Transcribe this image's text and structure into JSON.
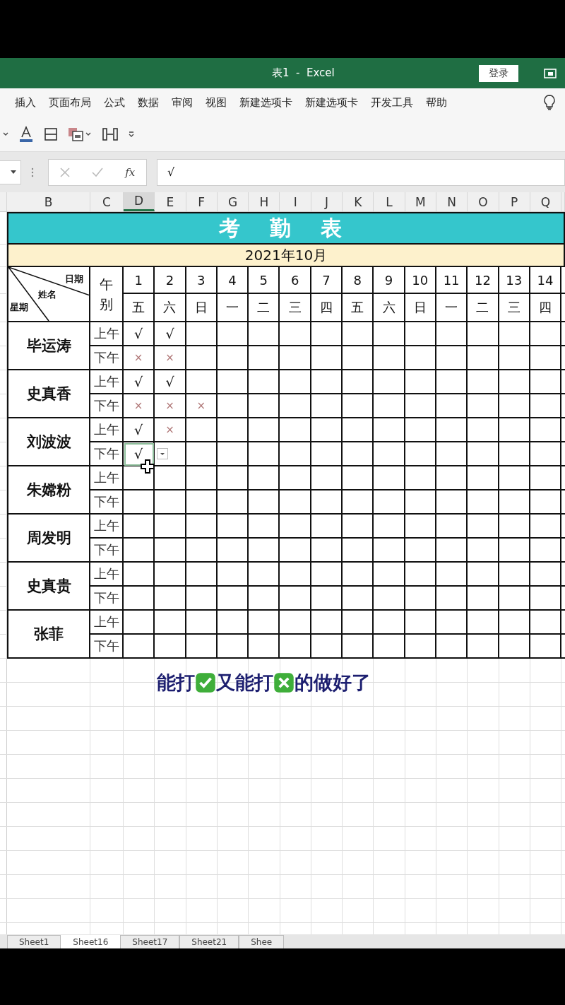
{
  "window": {
    "title": "表1  -  Excel",
    "login_button": "登录"
  },
  "ribbon_tabs": [
    "插入",
    "页面布局",
    "公式",
    "数据",
    "审阅",
    "视图",
    "新建选项卡",
    "新建选项卡",
    "开发工具",
    "帮助"
  ],
  "formula_bar": {
    "function_label": "fx",
    "value": "√"
  },
  "column_headers": [
    {
      "label": "B",
      "selected": false
    },
    {
      "label": "C",
      "selected": false
    },
    {
      "label": "D",
      "selected": true
    },
    {
      "label": "E",
      "selected": false
    },
    {
      "label": "F",
      "selected": false
    },
    {
      "label": "G",
      "selected": false
    },
    {
      "label": "H",
      "selected": false
    },
    {
      "label": "I",
      "selected": false
    },
    {
      "label": "J",
      "selected": false
    },
    {
      "label": "K",
      "selected": false
    },
    {
      "label": "L",
      "selected": false
    },
    {
      "label": "M",
      "selected": false
    },
    {
      "label": "N",
      "selected": false
    },
    {
      "label": "O",
      "selected": false
    },
    {
      "label": "P",
      "selected": false
    },
    {
      "label": "Q",
      "selected": false
    }
  ],
  "sheet": {
    "title": "考 勤 表",
    "month": "2021年10月",
    "corner": {
      "top": "日期",
      "middle": "姓名",
      "bottom": "星期"
    },
    "period_header": "午别",
    "days": [
      {
        "date": "1",
        "weekday": "五"
      },
      {
        "date": "2",
        "weekday": "六"
      },
      {
        "date": "3",
        "weekday": "日"
      },
      {
        "date": "4",
        "weekday": "一"
      },
      {
        "date": "5",
        "weekday": "二"
      },
      {
        "date": "6",
        "weekday": "三"
      },
      {
        "date": "7",
        "weekday": "四"
      },
      {
        "date": "8",
        "weekday": "五"
      },
      {
        "date": "9",
        "weekday": "六"
      },
      {
        "date": "10",
        "weekday": "日"
      },
      {
        "date": "11",
        "weekday": "一"
      },
      {
        "date": "12",
        "weekday": "二"
      },
      {
        "date": "13",
        "weekday": "三"
      },
      {
        "date": "14",
        "weekday": "四"
      }
    ],
    "employees": [
      {
        "name": "毕运涛",
        "rows": [
          {
            "period": "上午",
            "marks": [
              {
                "kind": "check",
                "value": "√",
                "selected": false
              },
              {
                "kind": "check",
                "value": "√",
                "selected": false
              }
            ]
          },
          {
            "period": "下午",
            "marks": [
              {
                "kind": "cross",
                "value": "×",
                "selected": false
              },
              {
                "kind": "cross",
                "value": "×",
                "selected": false
              }
            ]
          }
        ]
      },
      {
        "name": "史真香",
        "rows": [
          {
            "period": "上午",
            "marks": [
              {
                "kind": "check",
                "value": "√",
                "selected": false
              },
              {
                "kind": "check",
                "value": "√",
                "selected": false
              }
            ]
          },
          {
            "period": "下午",
            "marks": [
              {
                "kind": "cross",
                "value": "×",
                "selected": false
              },
              {
                "kind": "cross",
                "value": "×",
                "selected": false
              },
              {
                "kind": "cross",
                "value": "×",
                "selected": false
              }
            ]
          }
        ]
      },
      {
        "name": "刘波波",
        "rows": [
          {
            "period": "上午",
            "marks": [
              {
                "kind": "check",
                "value": "√",
                "selected": false
              },
              {
                "kind": "cross",
                "value": "×",
                "selected": false
              }
            ]
          },
          {
            "period": "下午",
            "marks": [
              {
                "kind": "check",
                "value": "√",
                "selected": true
              }
            ]
          }
        ]
      },
      {
        "name": "朱嫦粉",
        "rows": [
          {
            "period": "上午",
            "marks": []
          },
          {
            "period": "下午",
            "marks": []
          }
        ]
      },
      {
        "name": "周发明",
        "rows": [
          {
            "period": "上午",
            "marks": []
          },
          {
            "period": "下午",
            "marks": []
          }
        ]
      },
      {
        "name": "史真贵",
        "rows": [
          {
            "period": "上午",
            "marks": []
          },
          {
            "period": "下午",
            "marks": []
          }
        ]
      },
      {
        "name": "张菲",
        "rows": [
          {
            "period": "上午",
            "marks": []
          },
          {
            "period": "下午",
            "marks": []
          }
        ]
      }
    ]
  },
  "caption": [
    {
      "kind": "text",
      "text": "能打"
    },
    {
      "kind": "check-emoji"
    },
    {
      "kind": "text",
      "text": "又能打"
    },
    {
      "kind": "cross-emoji"
    },
    {
      "kind": "text",
      "text": "的做好了"
    }
  ],
  "sheet_tabs": [
    {
      "label": "Sheet1",
      "selected": false
    },
    {
      "label": "Sheet16",
      "selected": true
    },
    {
      "label": "Sheet17",
      "selected": false
    },
    {
      "label": "Sheet21",
      "selected": false
    },
    {
      "label": "Shee",
      "selected": false
    }
  ]
}
